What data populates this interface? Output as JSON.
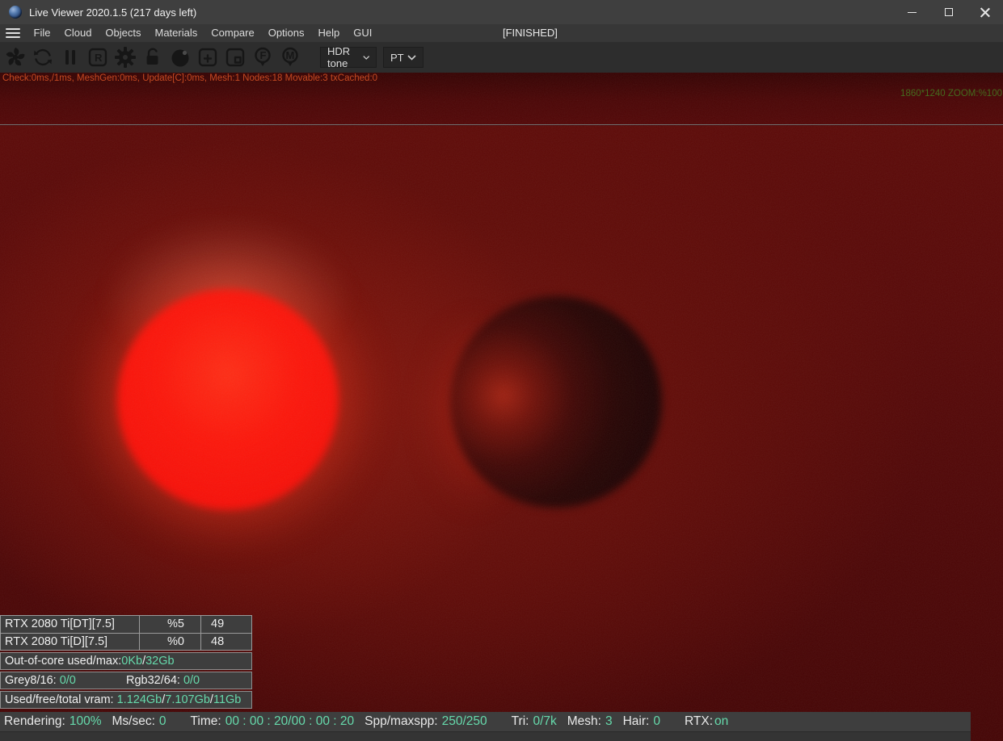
{
  "window": {
    "title": "Live Viewer 2020.1.5 (217 days left)",
    "controls": [
      "minimize",
      "maximize",
      "close"
    ]
  },
  "menu": {
    "items": [
      "File",
      "Cloud",
      "Objects",
      "Materials",
      "Compare",
      "Options",
      "Help",
      "GUI"
    ],
    "center_status": "[FINISHED]"
  },
  "toolbar": {
    "icons": [
      "octane-logo",
      "refresh-render",
      "pause-render",
      "restart-render",
      "kernel-settings",
      "lock-resolution",
      "material-ball",
      "add-render-region",
      "pick-render-region",
      "focus-picker",
      "material-picker"
    ],
    "restart_letter": "R",
    "focus_letter": "F",
    "material_letter": "M",
    "hdr_dropdown": "HDR tone",
    "kernel_dropdown": "PT"
  },
  "viewport": {
    "check_line": "Check:0ms,/1ms, MeshGen:0ms, Update[C]:0ms, Mesh:1 Nodes:18 Movable:3 txCached:0",
    "resolution_zoom": "1860*1240 ZOOM:%100"
  },
  "gpu_table": {
    "rows": [
      {
        "name": "RTX 2080 Ti[DT][7.5]",
        "load": "%5",
        "temp": "49"
      },
      {
        "name": "RTX 2080 Ti[D][7.5]",
        "load": "%0",
        "temp": "48"
      }
    ],
    "out_of_core": {
      "label": "Out-of-core used/max:",
      "used": "0Kb",
      "sep": "/",
      "max": "32Gb"
    },
    "textures": {
      "grey_label": "Grey8/16:",
      "grey_value": "0/0",
      "rgb_label": "Rgb32/64:",
      "rgb_value": "0/0"
    },
    "vram": {
      "label": "Used/free/total vram:",
      "used": "1.124Gb",
      "free": "7.107Gb",
      "total": "11Gb",
      "sep": "/"
    }
  },
  "status_bar": {
    "items": [
      {
        "label": "Rendering:",
        "value": "100%"
      },
      {
        "label": "Ms/sec:",
        "value": "0"
      },
      {
        "label": "Time:",
        "value": "00 : 00 : 20/00 : 00 : 20"
      },
      {
        "label": "Spp/maxspp:",
        "value": "250/250"
      },
      {
        "label": "Tri:",
        "value": "0/7k"
      },
      {
        "label": "Mesh:",
        "value": "3"
      },
      {
        "label": "Hair:",
        "value": "0"
      },
      {
        "label": "RTX:",
        "value": "on"
      }
    ]
  },
  "colors": {
    "value_teal": "#66d9ab",
    "check_orange": "#c54a22",
    "zoom_green": "#456b1e",
    "panel_grey": "#3e3e3e",
    "render_red": "#5b0806"
  }
}
